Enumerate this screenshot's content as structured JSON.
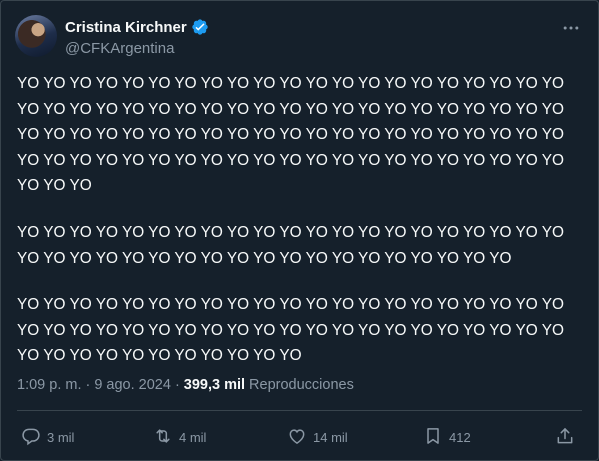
{
  "tweet": {
    "author": {
      "name": "Cristina Kirchner",
      "handle": "@CFKArgentina",
      "verified": true
    },
    "paragraphs": [
      "YO YO YO YO YO YO YO YO YO YO YO YO YO YO YO YO YO YO YO YO YO YO YO YO YO YO YO YO YO YO YO YO YO YO YO YO YO YO YO YO YO YO YO YO YO YO YO YO YO YO YO YO YO YO YO YO YO YO YO YO YO YO YO YO YO YO YO YO YO YO YO YO YO YO YO YO YO YO YO YO YO YO YO YO YO YO YO",
      "YO YO YO YO YO YO YO YO YO YO YO YO YO YO YO YO YO YO YO YO YO YO YO YO YO YO YO YO YO YO YO YO YO YO YO YO YO YO YO YO",
      "YO YO YO YO YO YO YO YO YO YO YO YO YO YO YO YO YO YO YO YO YO YO YO YO YO YO YO YO YO YO YO YO YO YO YO YO YO YO YO YO YO YO YO YO YO YO YO YO YO YO YO YO YO"
    ],
    "meta": {
      "time": "1:09 p. m.",
      "separator": "·",
      "date": "9 ago. 2024",
      "separator2": "·",
      "views_count": "399,3 mil",
      "views_label": "Reproducciones"
    },
    "actions": {
      "replies": "3 mil",
      "retweets": "4 mil",
      "likes": "14 mil",
      "bookmarks": "412"
    },
    "icons": {
      "more": "more-horizontal-icon",
      "reply": "reply-icon",
      "retweet": "retweet-icon",
      "like": "heart-icon",
      "bookmark": "bookmark-icon",
      "share": "share-icon",
      "verified": "verified-badge-icon"
    },
    "colors": {
      "background": "#15202b",
      "text": "#f7f9f9",
      "secondary": "#8b98a5",
      "verified": "#1d9bf0"
    }
  }
}
